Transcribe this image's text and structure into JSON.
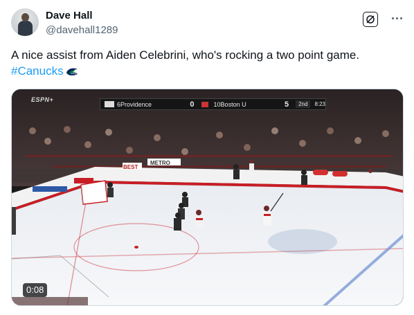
{
  "author": {
    "display_name": "Dave Hall",
    "handle": "@davehall1289"
  },
  "header_actions": {
    "grok_icon": "grok-icon",
    "more_icon": "more-icon"
  },
  "tweet": {
    "text": "A nice assist from Aiden Celebrini, who's rocking a two point game.",
    "hashtag": "#Canucks"
  },
  "video": {
    "broadcaster": "ESPN+",
    "scorebug": {
      "home_team": "6Providence",
      "home_score": "0",
      "away_team": "10Boston U",
      "away_score": "5",
      "period": "2nd",
      "clock": "8:23"
    },
    "board_ads": [
      "BEST",
      "METRO"
    ],
    "duration": "0:08"
  },
  "colors": {
    "link": "#1d9bf0",
    "secondary_text": "#536471",
    "primary_text": "#0f1419"
  }
}
